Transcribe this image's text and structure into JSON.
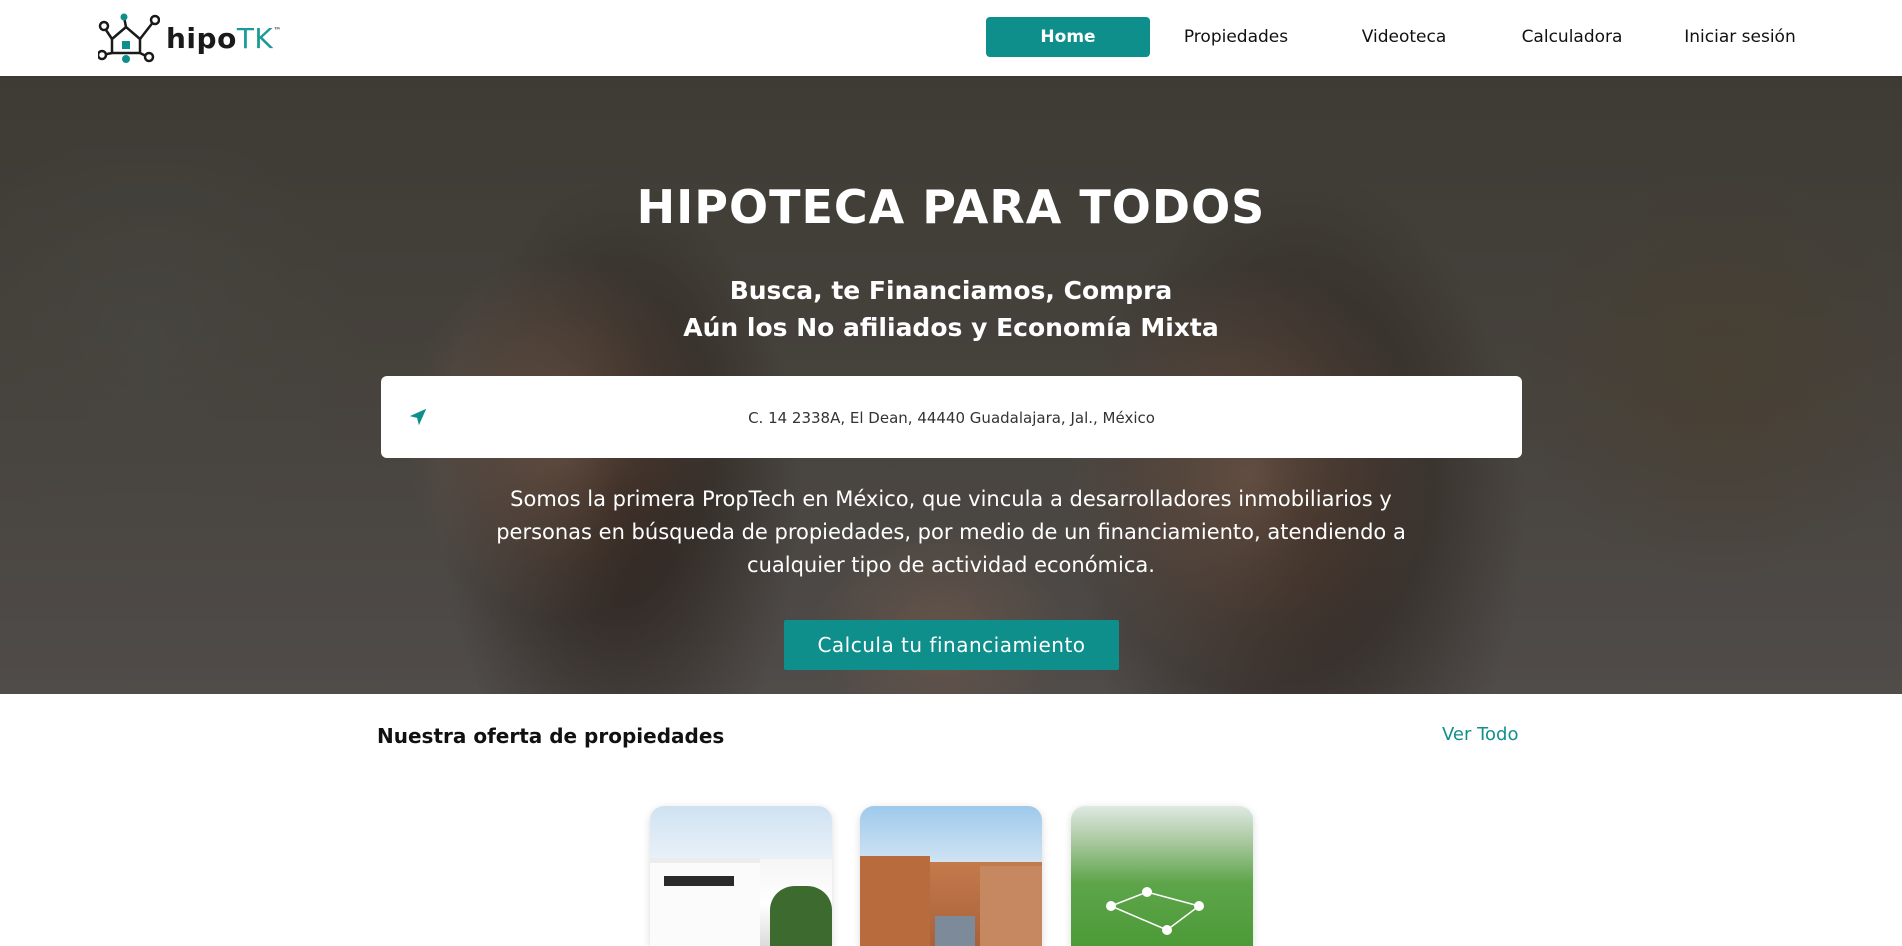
{
  "brand": {
    "name_main": "hipo",
    "name_accent": "TK",
    "trademark": "™",
    "accent_color": "#0e8f8b"
  },
  "nav": {
    "items": [
      {
        "label": "Home",
        "active": true
      },
      {
        "label": "Propiedades",
        "active": false
      },
      {
        "label": "Videoteca",
        "active": false
      },
      {
        "label": "Calculadora",
        "active": false
      },
      {
        "label": "Iniciar sesión",
        "active": false
      }
    ]
  },
  "hero": {
    "title": "HIPOTECA PARA TODOS",
    "subtitle_line1": "Busca, te Financiamos, Compra",
    "subtitle_line2": "Aún los No afiliados y Economía Mixta",
    "search": {
      "icon": "location-arrow-icon",
      "value": "C. 14 2338A, El Dean, 44440 Guadalajara, Jal., México"
    },
    "description": "Somos la primera PropTech en México, que vincula a desarrolladores inmobiliarios y personas en búsqueda de propiedades, por medio de un financiamiento, atendiendo a cualquier tipo de actividad económica.",
    "cta_label": "Calcula tu financiamiento"
  },
  "offers": {
    "title": "Nuestra oferta de propiedades",
    "see_all_label": "Ver Todo",
    "cards": [
      {
        "image": "modern-white-house-photo"
      },
      {
        "image": "apartment-buildings-photo"
      },
      {
        "image": "green-land-lots-photo"
      }
    ]
  }
}
